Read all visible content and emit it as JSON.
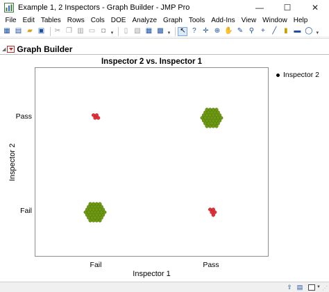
{
  "window": {
    "title": "Example 1,  2 Inspectors - Graph Builder - JMP Pro",
    "minimize": "—",
    "maximize": "☐",
    "close": "✕"
  },
  "menu": [
    "File",
    "Edit",
    "Tables",
    "Rows",
    "Cols",
    "DOE",
    "Analyze",
    "Graph",
    "Tools",
    "Add-Ins",
    "View",
    "Window",
    "Help"
  ],
  "toolbar_icons": [
    "app-grid-icon",
    "new-table-icon",
    "open-icon",
    "save-icon",
    "cut-icon",
    "copy-icon",
    "paste-icon",
    "print-icon",
    "lock-icon",
    "journal-icon",
    "copy-picture-icon",
    "arrow-select-icon",
    "help-icon",
    "crosshair-icon",
    "brush-icon",
    "hand-icon",
    "lasso-icon",
    "magnifier-icon",
    "plus-icon",
    "line-icon",
    "annotate-icon",
    "text-icon",
    "simple-shape-icon"
  ],
  "graph_builder": {
    "title": "Graph Builder"
  },
  "chart_data": {
    "type": "scatter",
    "title": "Inspector 2 vs. Inspector 1",
    "xlabel": "Inspector 1",
    "ylabel": "Inspector 2",
    "x_categories": [
      "Fail",
      "Pass"
    ],
    "y_categories": [
      "Fail",
      "Pass"
    ],
    "legend": {
      "entries": [
        "Inspector 2"
      ],
      "placement": "right"
    },
    "series": [
      {
        "x": "Fail",
        "y": "Fail",
        "count": 37,
        "color": "#6e9a12"
      },
      {
        "x": "Fail",
        "y": "Pass",
        "count": 4,
        "color": "#e0303a"
      },
      {
        "x": "Pass",
        "y": "Fail",
        "count": 5,
        "color": "#e0303a"
      },
      {
        "x": "Pass",
        "y": "Pass",
        "count": 37,
        "color": "#6e9a12"
      }
    ],
    "grid": false
  },
  "colors": {
    "agree": "#6e9a12",
    "disagree": "#e0303a"
  }
}
